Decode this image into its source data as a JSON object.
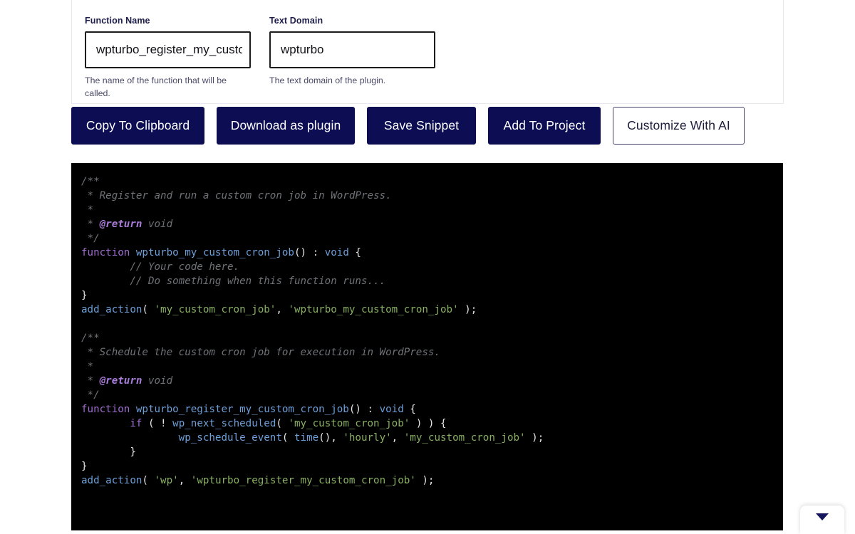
{
  "form": {
    "fields": [
      {
        "label": "Function Name",
        "value": "wpturbo_register_my_custom_cron_job",
        "placeholder": "wpturbo_register_my_custom_cron_job",
        "help": "The name of the function that will be called."
      },
      {
        "label": "Text Domain",
        "value": "wpturbo",
        "placeholder": "wpturbo",
        "help": "The text domain of the plugin."
      }
    ]
  },
  "toolbar": {
    "buttons": [
      {
        "label": "Copy To Clipboard",
        "style": "primary"
      },
      {
        "label": "Download as plugin",
        "style": "primary"
      },
      {
        "label": "Save Snippet",
        "style": "primary"
      },
      {
        "label": "Add To Project",
        "style": "primary"
      },
      {
        "label": "Customize With AI",
        "style": "outline"
      }
    ]
  },
  "code": {
    "language": "php",
    "background": "#000000",
    "lines": [
      [
        {
          "t": "/**",
          "c": "comment"
        }
      ],
      [
        {
          "t": " * Register and run a custom cron job in WordPress.",
          "c": "comment"
        }
      ],
      [
        {
          "t": " *",
          "c": "comment"
        }
      ],
      [
        {
          "t": " * ",
          "c": "comment"
        },
        {
          "t": "@return",
          "c": "doctag"
        },
        {
          "t": " void",
          "c": "comment"
        }
      ],
      [
        {
          "t": " */",
          "c": "comment"
        }
      ],
      [
        {
          "t": "function",
          "c": "keyword"
        },
        {
          "t": " ",
          "c": "plain"
        },
        {
          "t": "wpturbo_my_custom_cron_job",
          "c": "func"
        },
        {
          "t": "()",
          "c": "punct"
        },
        {
          "t": " : ",
          "c": "plain"
        },
        {
          "t": "void",
          "c": "type"
        },
        {
          "t": " {",
          "c": "punct"
        }
      ],
      [
        {
          "t": "        ",
          "c": "plain"
        },
        {
          "t": "// Your code here.",
          "c": "comment"
        }
      ],
      [
        {
          "t": "        ",
          "c": "plain"
        },
        {
          "t": "// Do something when this function runs...",
          "c": "comment"
        }
      ],
      [
        {
          "t": "}",
          "c": "punct"
        }
      ],
      [
        {
          "t": "add_action",
          "c": "func"
        },
        {
          "t": "( ",
          "c": "punct"
        },
        {
          "t": "'my_custom_cron_job'",
          "c": "string"
        },
        {
          "t": ", ",
          "c": "punct"
        },
        {
          "t": "'wpturbo_my_custom_cron_job'",
          "c": "string"
        },
        {
          "t": " );",
          "c": "punct"
        }
      ],
      [
        {
          "t": "",
          "c": "plain"
        }
      ],
      [
        {
          "t": "/**",
          "c": "comment"
        }
      ],
      [
        {
          "t": " * Schedule the custom cron job for execution in WordPress.",
          "c": "comment"
        }
      ],
      [
        {
          "t": " *",
          "c": "comment"
        }
      ],
      [
        {
          "t": " * ",
          "c": "comment"
        },
        {
          "t": "@return",
          "c": "doctag"
        },
        {
          "t": " void",
          "c": "comment"
        }
      ],
      [
        {
          "t": " */",
          "c": "comment"
        }
      ],
      [
        {
          "t": "function",
          "c": "keyword"
        },
        {
          "t": " ",
          "c": "plain"
        },
        {
          "t": "wpturbo_register_my_custom_cron_job",
          "c": "func"
        },
        {
          "t": "()",
          "c": "punct"
        },
        {
          "t": " : ",
          "c": "plain"
        },
        {
          "t": "void",
          "c": "type"
        },
        {
          "t": " {",
          "c": "punct"
        }
      ],
      [
        {
          "t": "        ",
          "c": "plain"
        },
        {
          "t": "if",
          "c": "keyword"
        },
        {
          "t": " ( ! ",
          "c": "punct"
        },
        {
          "t": "wp_next_scheduled",
          "c": "func"
        },
        {
          "t": "( ",
          "c": "punct"
        },
        {
          "t": "'my_custom_cron_job'",
          "c": "string"
        },
        {
          "t": " ) ) {",
          "c": "punct"
        }
      ],
      [
        {
          "t": "                ",
          "c": "plain"
        },
        {
          "t": "wp_schedule_event",
          "c": "func"
        },
        {
          "t": "( ",
          "c": "punct"
        },
        {
          "t": "time",
          "c": "func"
        },
        {
          "t": "(), ",
          "c": "punct"
        },
        {
          "t": "'hourly'",
          "c": "string"
        },
        {
          "t": ", ",
          "c": "punct"
        },
        {
          "t": "'my_custom_cron_job'",
          "c": "string"
        },
        {
          "t": " );",
          "c": "punct"
        }
      ],
      [
        {
          "t": "        ",
          "c": "plain"
        },
        {
          "t": "}",
          "c": "punct"
        }
      ],
      [
        {
          "t": "}",
          "c": "punct"
        }
      ],
      [
        {
          "t": "add_action",
          "c": "func"
        },
        {
          "t": "( ",
          "c": "punct"
        },
        {
          "t": "'wp'",
          "c": "string"
        },
        {
          "t": ", ",
          "c": "punct"
        },
        {
          "t": "'wpturbo_register_my_custom_cron_job'",
          "c": "string"
        },
        {
          "t": " );",
          "c": "punct"
        }
      ]
    ]
  },
  "float_widget": {
    "icon": "chevron-down-icon"
  },
  "colors": {
    "primary_button": "#0d0d54",
    "label_text": "#1d1d4b",
    "code_background": "#000000",
    "string_token": "#88b060",
    "keyword_token": "#a06ccf",
    "function_token": "#6d9fd8",
    "comment_token": "#6f7277",
    "doctag_token": "#a97bd8"
  }
}
